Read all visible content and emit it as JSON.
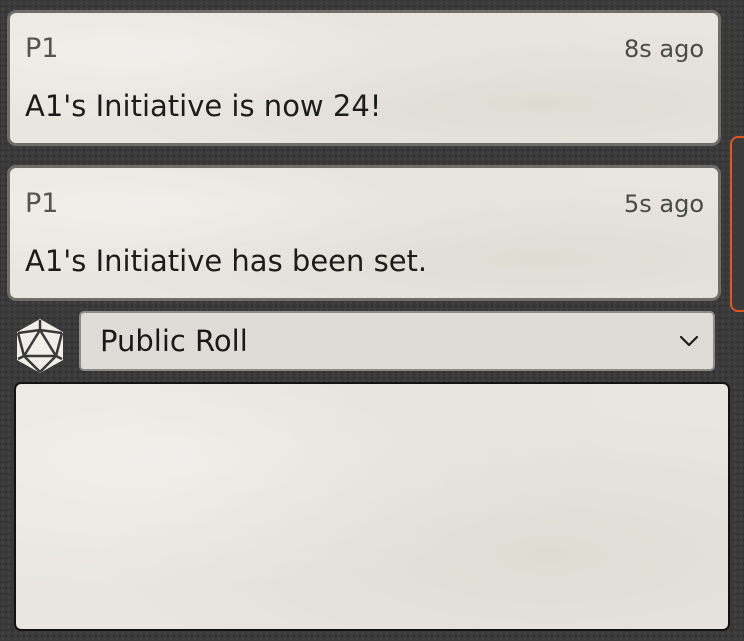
{
  "chat": {
    "messages": [
      {
        "sender": "P1",
        "time": "8s ago",
        "text": "A1's Initiative is now 24!"
      },
      {
        "sender": "P1",
        "time": "5s ago",
        "text": "A1's Initiative has been set."
      }
    ]
  },
  "roll_mode": {
    "icon": "d20-dice-icon",
    "selected": "Public Roll",
    "dropdown_icon": "chevron-down-icon"
  },
  "chat_input": {
    "value": ""
  },
  "colors": {
    "scrollbar_accent": "#e0591c",
    "parchment": "#e8e6df",
    "background": "#3a3a3a"
  }
}
